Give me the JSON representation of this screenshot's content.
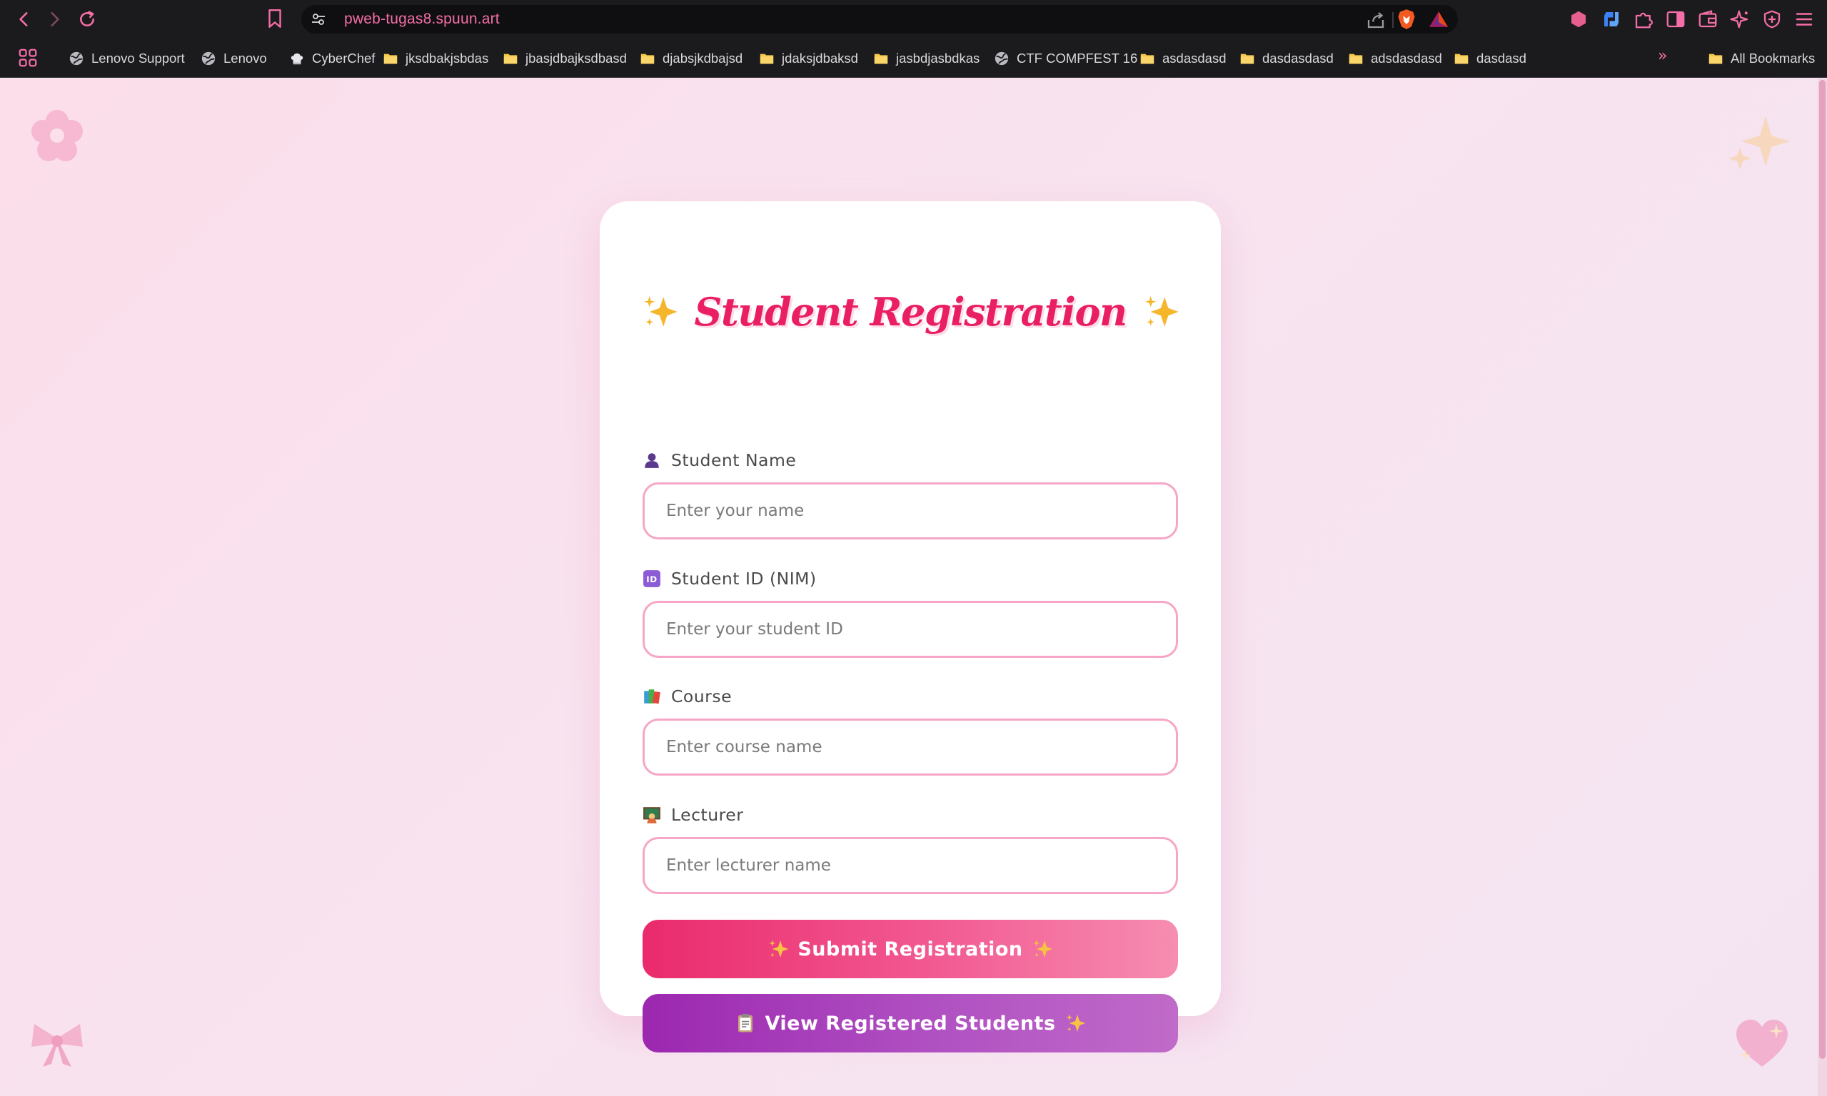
{
  "browser": {
    "url": "pweb-tugas8.spuun.art",
    "bookmarks": [
      {
        "label": "Lenovo Support",
        "icon": "globe-icon"
      },
      {
        "label": "Lenovo",
        "icon": "globe-icon"
      },
      {
        "label": "CyberChef",
        "icon": "chef-hat-icon"
      },
      {
        "label": "jksdbakjsbdas",
        "icon": "folder-icon"
      },
      {
        "label": "jbasjdbajksdbasd",
        "icon": "folder-icon"
      },
      {
        "label": "djabsjkdbajsd",
        "icon": "folder-icon"
      },
      {
        "label": "jdaksjdbaksd",
        "icon": "folder-icon"
      },
      {
        "label": "jasbdjasbdkas",
        "icon": "folder-icon"
      },
      {
        "label": "CTF COMPFEST 16",
        "icon": "globe-icon"
      },
      {
        "label": "asdasdasd",
        "icon": "folder-icon"
      },
      {
        "label": "dasdasdasd",
        "icon": "folder-icon"
      },
      {
        "label": "adsdasdasd",
        "icon": "folder-icon"
      },
      {
        "label": "dasdasd",
        "icon": "folder-icon"
      }
    ],
    "more_label": "»",
    "all_bookmarks": "All Bookmarks"
  },
  "form": {
    "title": "Student Registration",
    "fields": [
      {
        "label": "Student Name",
        "placeholder": "Enter your name",
        "value": "",
        "icon": "person-icon"
      },
      {
        "label": "Student ID (NIM)",
        "placeholder": "Enter your student ID",
        "value": "",
        "icon": "id-badge-icon"
      },
      {
        "label": "Course",
        "placeholder": "Enter course name",
        "value": "",
        "icon": "books-icon"
      },
      {
        "label": "Lecturer",
        "placeholder": "Enter lecturer name",
        "value": "",
        "icon": "teacher-icon"
      }
    ],
    "submit_label": "Submit Registration",
    "view_label": "View Registered Students"
  },
  "colors": {
    "accent": "#e91e63",
    "input_border": "#f6a6c6",
    "submit_gradient": [
      "#ea2a6c",
      "#f68db1"
    ],
    "view_gradient": [
      "#9c27b0",
      "#c06ac9"
    ],
    "page_bg": "#f9e2ee",
    "url_text": "#f46ea7"
  }
}
